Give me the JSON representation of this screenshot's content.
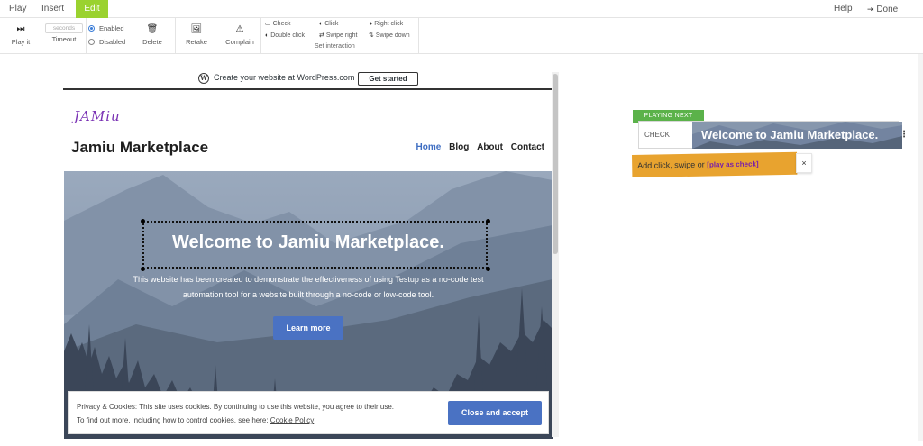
{
  "menu": {
    "play": "Play",
    "insert": "Insert",
    "edit": "Edit",
    "help": "Help",
    "done": "Done"
  },
  "ribbon": {
    "play_it": "Play it",
    "seconds_placeholder": "seconds",
    "timeout": "Timeout",
    "enabled": "Enabled",
    "disabled": "Disabled",
    "delete": "Delete",
    "retake": "Retake",
    "complain": "Complain",
    "interactions": {
      "check": "Check",
      "double_click": "Double click",
      "click": "Click",
      "swipe_right": "Swipe right",
      "right_click": "Right click",
      "swipe_down": "Swipe down",
      "caption": "Set interaction"
    }
  },
  "page": {
    "wp_bar_text": "Create your website at WordPress.com",
    "wp_bar_button": "Get started",
    "logo_text": "JAMiu",
    "site_title": "Jamiu Marketplace",
    "nav": [
      "Home",
      "Blog",
      "About",
      "Contact"
    ],
    "hero_title": "Welcome to Jamiu Marketplace.",
    "hero_description_1": "This website has been created to demonstrate the effectiveness of using Testup as a no-code test",
    "hero_description_2": "automation tool for a website built through a no-code or low-code tool.",
    "learn_more": "Learn more",
    "cookie_line_1": "Privacy & Cookies: This site uses cookies. By continuing to use this website, you agree to their use.",
    "cookie_line_2": "To find out more, including how to control cookies, see here:",
    "cookie_link": "Cookie Policy",
    "cookie_button": "Close and accept"
  },
  "playing_next": {
    "badge": "PLAYING NEXT",
    "step_type": "CHECK",
    "thumb_text": "Welcome to Jamiu Marketplace.",
    "hint_text": "Add click, swipe or ",
    "hint_link": "[play as check]",
    "close": "×"
  },
  "colors": {
    "edit_tab": "#9ad22f",
    "accent_blue": "#4a72c3",
    "playing_next_green": "#5bb24a",
    "hint_orange": "#e8a32f",
    "logo_purple": "#7a32b4"
  }
}
